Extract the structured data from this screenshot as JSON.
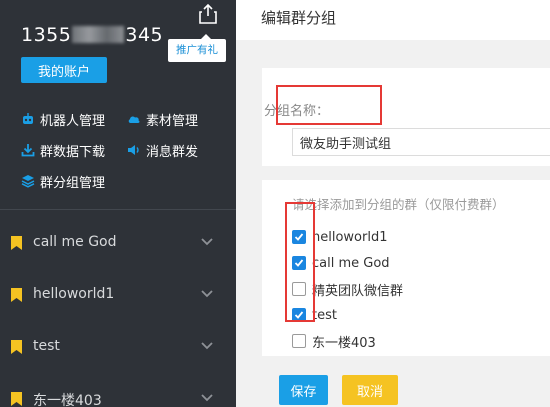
{
  "sidebar": {
    "phone_prefix": "1355",
    "phone_suffix": "345",
    "account_button": "我的账户",
    "tooltip": "推广有礼",
    "menu": [
      {
        "label": "机器人管理",
        "icon": "robot-icon"
      },
      {
        "label": "素材管理",
        "icon": "cloud-icon"
      },
      {
        "label": "群数据下载",
        "icon": "download-icon"
      },
      {
        "label": "消息群发",
        "icon": "broadcast-icon"
      },
      {
        "label": "群分组管理",
        "icon": "layers-icon"
      }
    ],
    "groups": [
      {
        "name": "call me God"
      },
      {
        "name": "helloworld1"
      },
      {
        "name": "test"
      },
      {
        "name": "东一楼403"
      }
    ]
  },
  "main": {
    "title": "编辑群分组",
    "group_name_label": "分组名称：",
    "group_name_value": "微友助手测试组",
    "select_label": "请选择添加到分组的群（仅限付费群）",
    "options": [
      {
        "label": "helloworld1",
        "checked": true
      },
      {
        "label": "call me God",
        "checked": true
      },
      {
        "label": "精英团队微信群",
        "checked": false
      },
      {
        "label": "test",
        "checked": true
      },
      {
        "label": "东一楼403",
        "checked": false
      }
    ],
    "save_label": "保存",
    "cancel_label": "取消"
  },
  "colors": {
    "sidebar_bg": "#2e3238",
    "accent_blue": "#1a9fe6",
    "bookmark_yellow": "#f5c322",
    "highlight_red": "#e53935"
  }
}
